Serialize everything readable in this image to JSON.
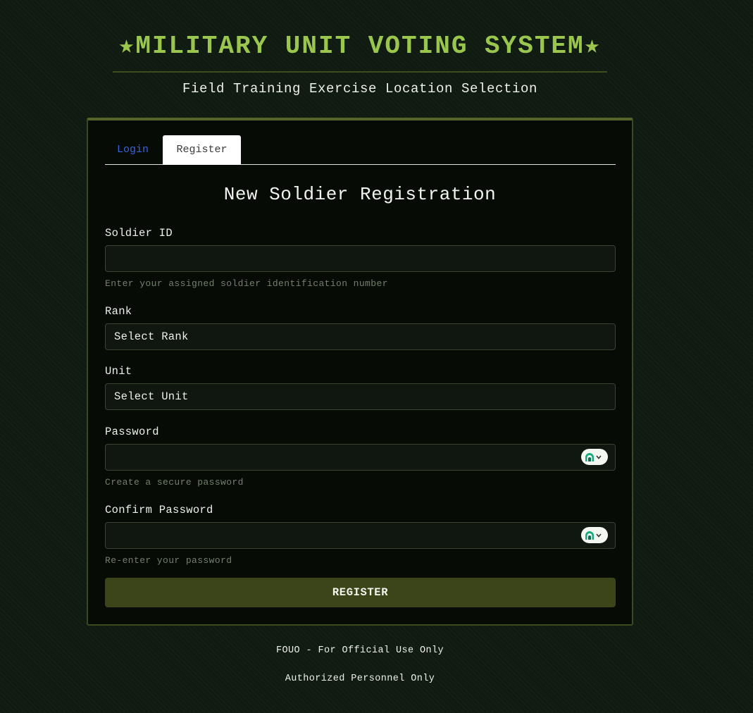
{
  "header": {
    "title": "★MILITARY UNIT VOTING SYSTEM★",
    "subtitle": "Field Training Exercise Location Selection"
  },
  "tabs": [
    {
      "label": "Login",
      "active": false
    },
    {
      "label": "Register",
      "active": true
    }
  ],
  "form": {
    "title": "New Soldier Registration",
    "soldier_id": {
      "label": "Soldier ID",
      "value": "",
      "hint": "Enter your assigned soldier identification number"
    },
    "rank": {
      "label": "Rank",
      "selected": "Select Rank"
    },
    "unit": {
      "label": "Unit",
      "selected": "Select Unit"
    },
    "password": {
      "label": "Password",
      "value": "",
      "hint": "Create a secure password"
    },
    "confirm_password": {
      "label": "Confirm Password",
      "value": "",
      "hint": "Re-enter your password"
    },
    "submit_label": "REGISTER"
  },
  "footer": {
    "line1": "FOUO - For Official Use Only",
    "line2": "Authorized Personnel Only"
  },
  "colors": {
    "accent": "#9bc64e",
    "button": "#3b4519",
    "link": "#3a63d8",
    "background": "#0f1a10",
    "card": "#060b06"
  },
  "icons": {
    "password_manager": "password-manager-icon"
  }
}
